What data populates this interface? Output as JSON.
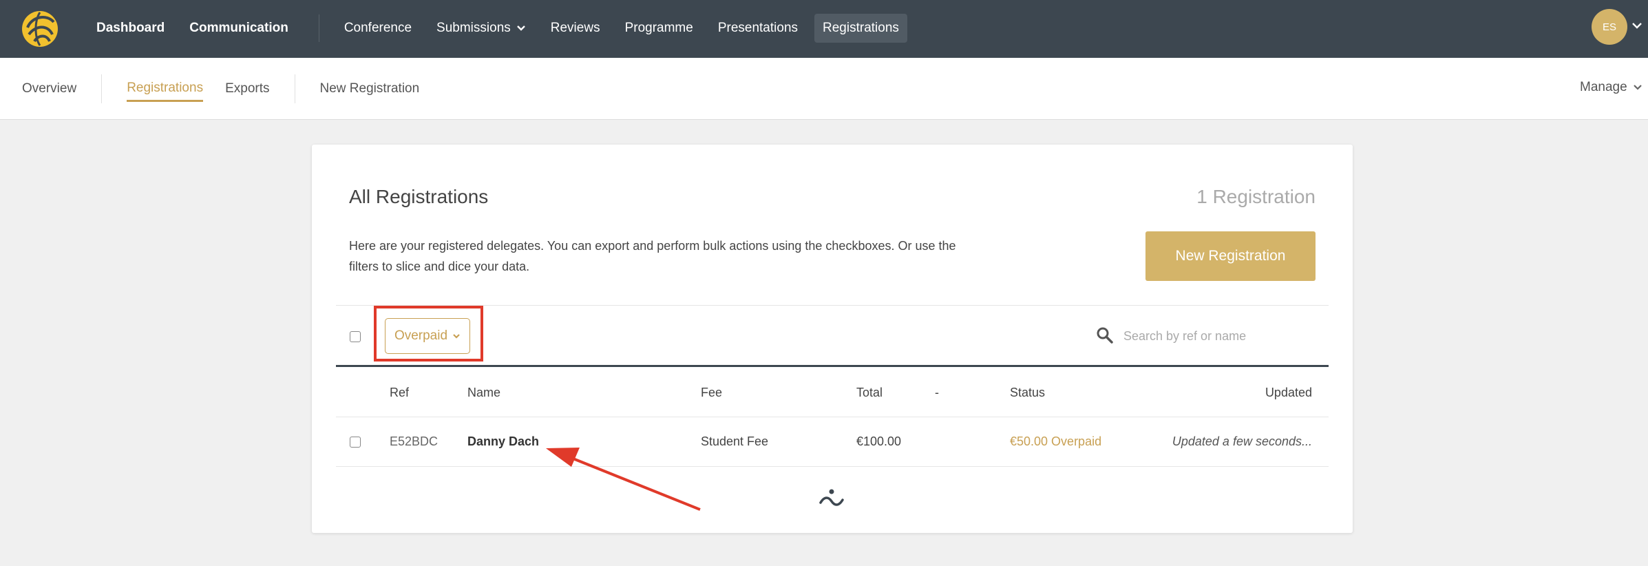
{
  "topnav": {
    "items": [
      {
        "label": "Dashboard"
      },
      {
        "label": "Communication"
      },
      {
        "label": "Conference"
      },
      {
        "label": "Submissions"
      },
      {
        "label": "Reviews"
      },
      {
        "label": "Programme"
      },
      {
        "label": "Presentations"
      },
      {
        "label": "Registrations"
      }
    ],
    "active": "Registrations",
    "user_initials": "ES"
  },
  "subnav": {
    "items": [
      {
        "label": "Overview"
      },
      {
        "label": "Registrations"
      },
      {
        "label": "Exports"
      },
      {
        "label": "New Registration"
      }
    ],
    "active": "Registrations",
    "manage_label": "Manage"
  },
  "card": {
    "title": "All Registrations",
    "count": "1 Registration",
    "description": "Here are your registered delegates. You can export and perform bulk actions using the checkboxes. Or use the filters to slice and dice your data.",
    "new_button": "New Registration",
    "filter": {
      "selected": "Overpaid"
    },
    "search": {
      "placeholder": "Search by ref or name",
      "value": ""
    },
    "table": {
      "headers": {
        "ref": "Ref",
        "name": "Name",
        "fee": "Fee",
        "total": "Total",
        "dash": "-",
        "status": "Status",
        "updated": "Updated"
      },
      "rows": [
        {
          "ref": "E52BDC",
          "name": "Danny Dach",
          "fee": "Student Fee",
          "total": "€100.00",
          "dash": "",
          "status": "€50.00 Overpaid",
          "updated": "Updated a few seconds..."
        }
      ]
    }
  },
  "colors": {
    "topbar": "#3d4750",
    "accent": "#c8a053",
    "button": "#d4b469",
    "annotation": "#e03a2a"
  }
}
